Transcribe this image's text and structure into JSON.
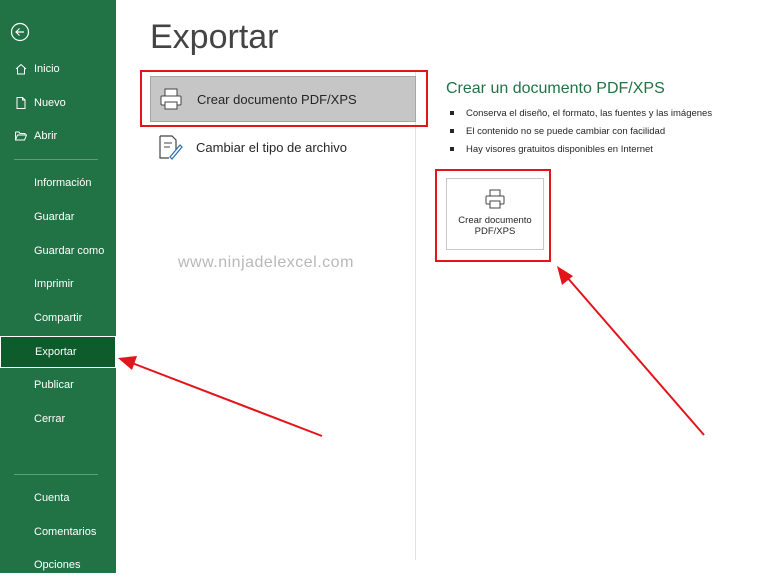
{
  "sidebar": {
    "top_items": [
      {
        "label": "Inicio",
        "icon": "home-icon"
      },
      {
        "label": "Nuevo",
        "icon": "new-document-icon"
      },
      {
        "label": "Abrir",
        "icon": "folder-open-icon"
      }
    ],
    "mid_items": [
      "Información",
      "Guardar",
      "Guardar como",
      "Imprimir",
      "Compartir",
      "Exportar",
      "Publicar",
      "Cerrar"
    ],
    "bottom_items": [
      "Cuenta",
      "Comentarios",
      "Opciones"
    ],
    "active": "Exportar"
  },
  "main": {
    "title": "Exportar",
    "options": [
      {
        "label": "Crear documento PDF/XPS",
        "icon": "pdf-printer-icon",
        "selected": true
      },
      {
        "label": "Cambiar el tipo de archivo",
        "icon": "change-filetype-icon",
        "selected": false
      }
    ]
  },
  "detail": {
    "title": "Crear un documento PDF/XPS",
    "bullets": [
      "Conserva el diseño, el formato, las fuentes y las imágenes",
      "El contenido no se puede cambiar con facilidad",
      "Hay visores gratuitos disponibles en Internet"
    ],
    "button_line1": "Crear documento",
    "button_line2": "PDF/XPS"
  },
  "watermark": "www.ninjadelexcel.com",
  "colors": {
    "sidebar": "#217346",
    "active": "#0e5b2b",
    "highlight": "#e4141b",
    "accent_text": "#217346"
  }
}
